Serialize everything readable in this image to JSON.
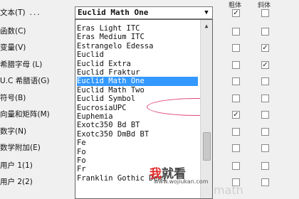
{
  "labels": [
    {
      "text": "文本(T)",
      "dots": "..."
    },
    {
      "text": "函数(C)",
      "dots": ""
    },
    {
      "text": "变量(V)",
      "dots": ""
    },
    {
      "text": "希腊字母 (L)",
      "dots": ""
    },
    {
      "text": "U.C 希腊语(G)",
      "dots": ""
    },
    {
      "text": "符号(B)",
      "dots": ""
    },
    {
      "text": "向量和矩阵(M)",
      "dots": ""
    },
    {
      "text": "数字(N)",
      "dots": ""
    },
    {
      "text": "数学附加(E)",
      "dots": ""
    },
    {
      "text": "用户 1(1)",
      "dots": ""
    },
    {
      "text": "用户 2(2)",
      "dots": ""
    }
  ],
  "font_combo": {
    "value": "Euclid Math One"
  },
  "font_list": [
    "Eras Light ITC",
    "Eras Medium ITC",
    "Estrangelo Edessa",
    "Euclid",
    "Euclid Extra",
    "Euclid Fraktur",
    "Euclid Math One",
    "Euclid Math Two",
    "Euclid Symbol",
    "EucrosiaUPC",
    "Euphemia",
    "Exotc350 Bd BT",
    "Exotc350 DmBd BT",
    "Fe",
    "Fo",
    "Fo",
    "Fr",
    "Franklin Gothic Demi"
  ],
  "selected_index": 6,
  "checkbox_headers": [
    "粗体",
    "斜体"
  ],
  "checkbox_col1": [
    true,
    false,
    false,
    false,
    false,
    false,
    true,
    false,
    false,
    false,
    false
  ],
  "checkbox_col2": [
    false,
    false,
    true,
    true,
    false,
    false,
    false,
    false,
    false,
    false,
    false
  ],
  "watermark": {
    "main_red": "我",
    "main_rest": "就看",
    "sub": "www.wojiukan.com"
  },
  "bg_text": "math"
}
